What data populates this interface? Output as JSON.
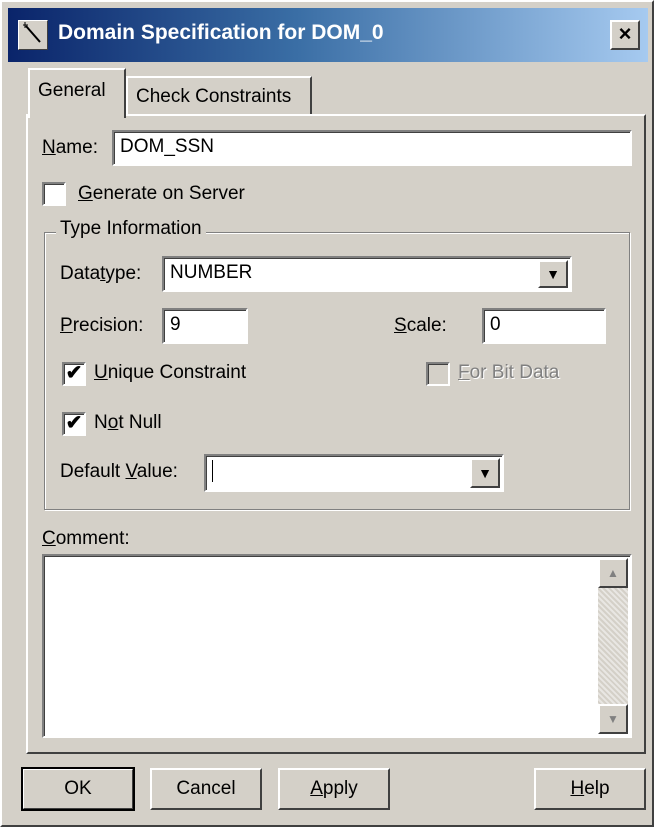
{
  "window": {
    "title": "Domain Specification for DOM_0",
    "close_label": "×"
  },
  "tabs": [
    {
      "label": "General",
      "active": true
    },
    {
      "label": "Check Constraints",
      "active": false
    }
  ],
  "name_field": {
    "label_mnemonic": "N",
    "label_rest": "ame:",
    "value": "DOM_SSN"
  },
  "generate_on_server": {
    "mnemonic": "G",
    "rest": "enerate on Server",
    "checked": false
  },
  "type_info": {
    "title": "Type Information",
    "datatype": {
      "label_pre": "Data",
      "label_mnemonic": "t",
      "label_post": "ype:",
      "value": "NUMBER"
    },
    "precision": {
      "label_mnemonic": "P",
      "label_rest": "recision:",
      "value": "9"
    },
    "scale": {
      "label_mnemonic": "S",
      "label_rest": "cale:",
      "value": "0"
    },
    "unique_constraint": {
      "mnemonic": "U",
      "rest": "nique Constraint",
      "checked": true,
      "check_glyph": "✔"
    },
    "for_bit_data": {
      "mnemonic": "F",
      "rest": "or Bit Data",
      "checked": false,
      "enabled": false
    },
    "not_null": {
      "pre": "N",
      "mnemonic": "o",
      "rest": "t Null",
      "checked": true,
      "check_glyph": "✔"
    },
    "default_value": {
      "label_pre": "Default ",
      "label_mnemonic": "V",
      "label_post": "alue:",
      "value": ""
    }
  },
  "comment": {
    "label_mnemonic": "C",
    "label_rest": "omment:",
    "value": ""
  },
  "buttons": {
    "ok": "OK",
    "cancel": "Cancel",
    "apply_mnemonic": "A",
    "apply_rest": "pply",
    "help_mnemonic": "H",
    "help_rest": "elp"
  },
  "icons": {
    "title_icon": "wand-icon",
    "dropdown_arrow": "▼",
    "scroll_up": "▲",
    "scroll_down": "▼"
  }
}
